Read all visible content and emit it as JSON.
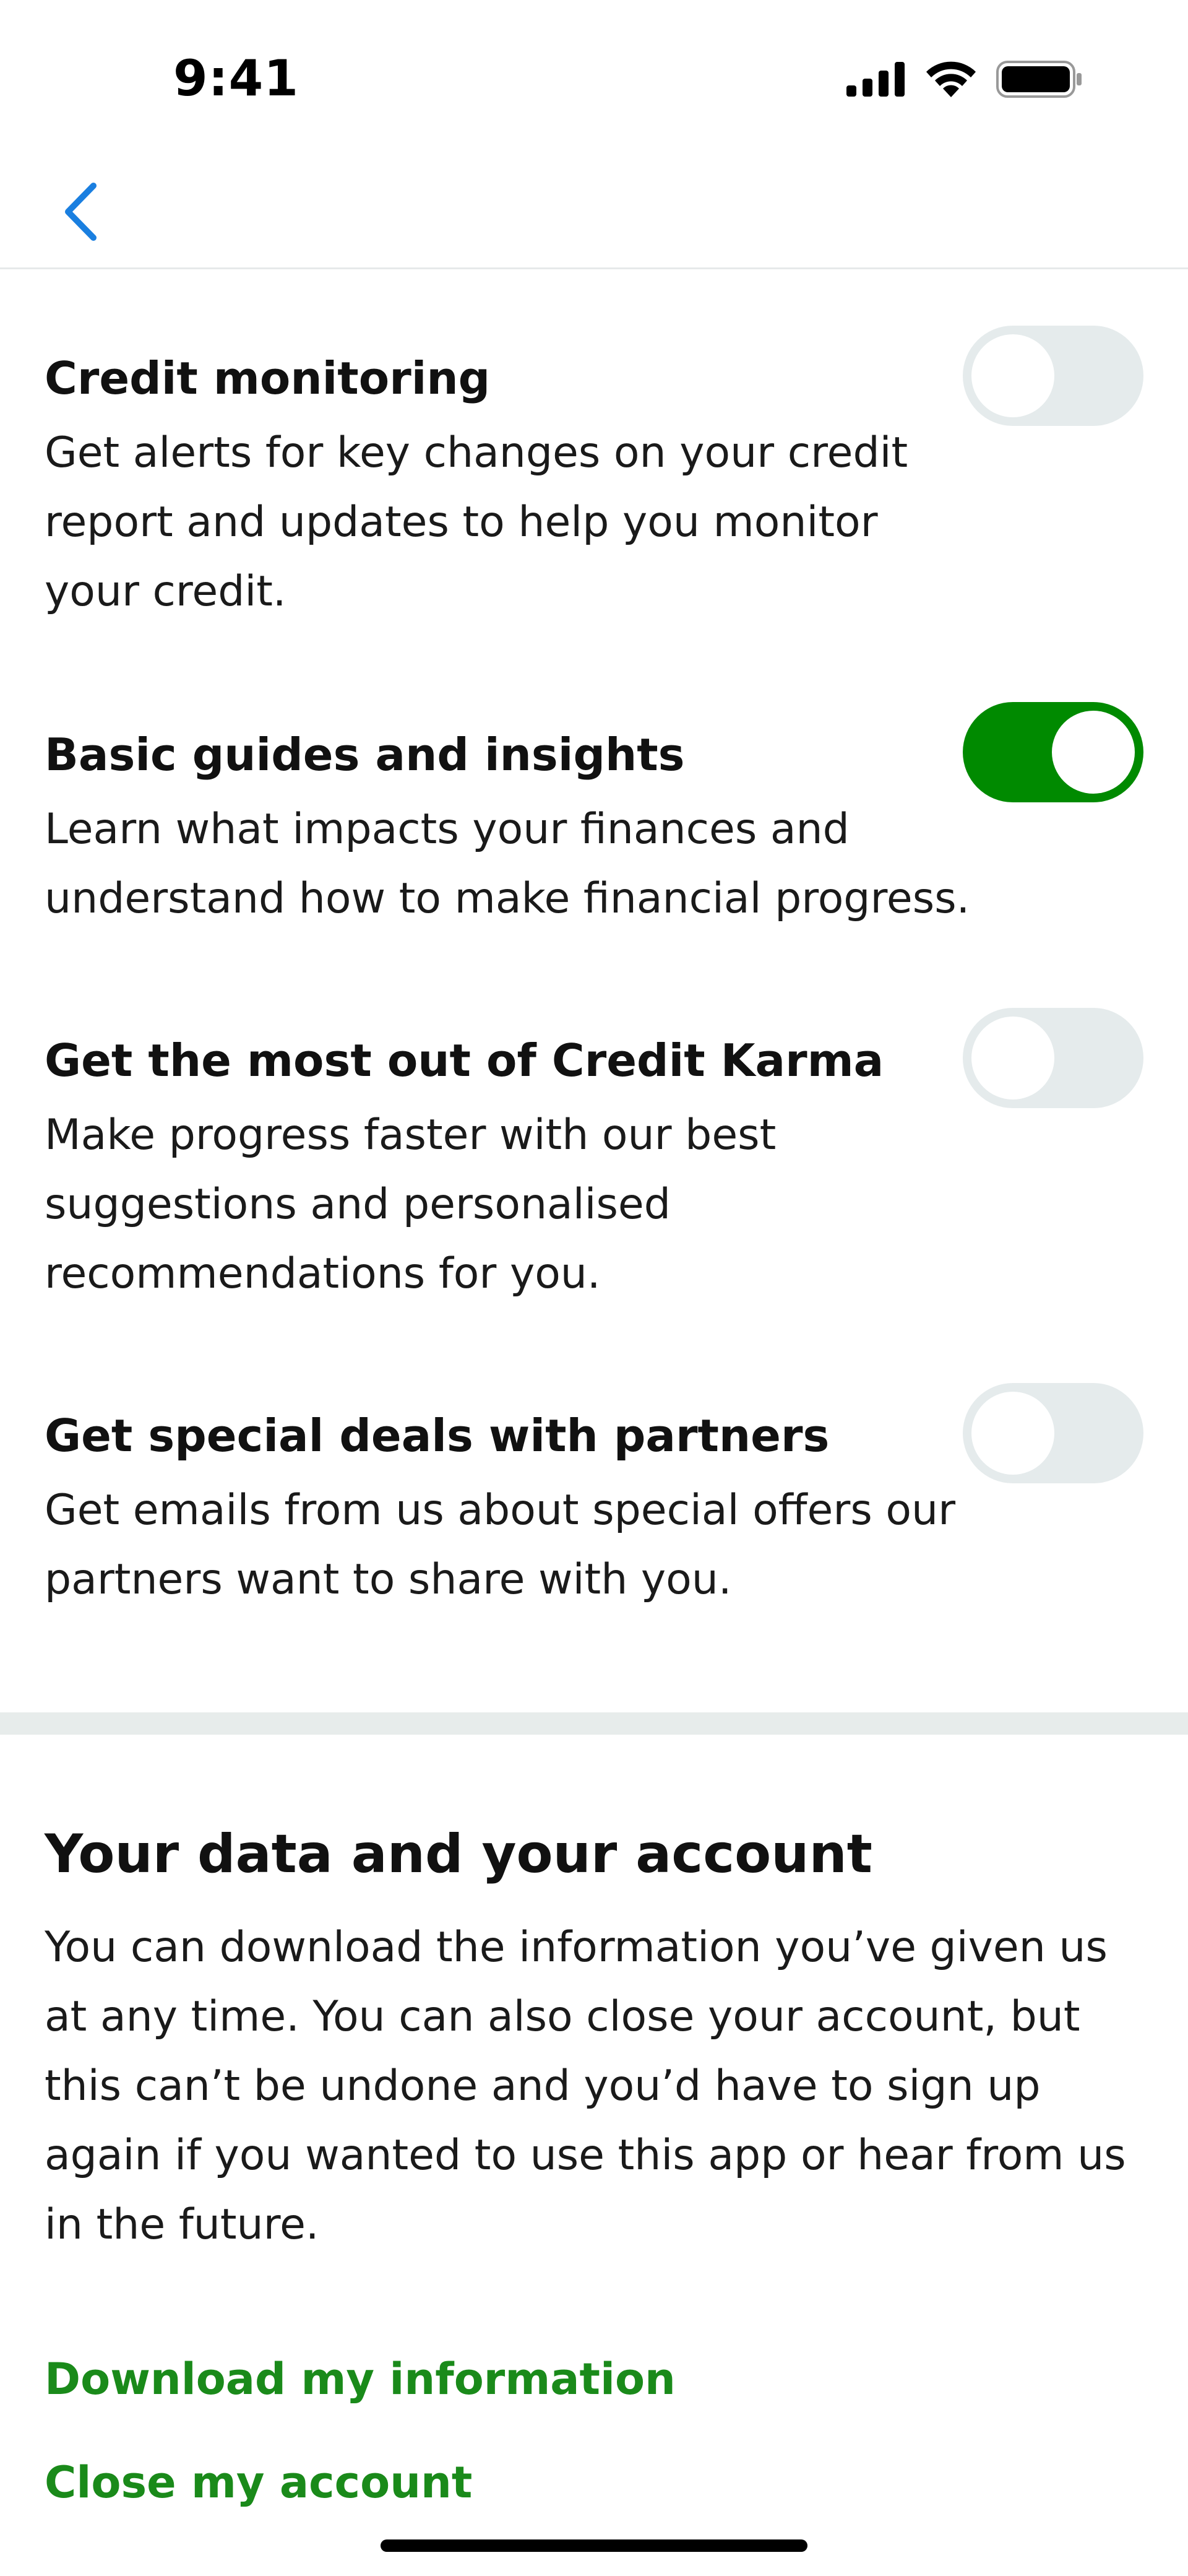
{
  "status_bar": {
    "time": "9:41",
    "icons": [
      "cellular-signal-icon",
      "wifi-icon",
      "battery-icon"
    ]
  },
  "nav": {
    "back_icon": "chevron-left-icon",
    "accent_color": "#1a7fe0"
  },
  "preferences": [
    {
      "title": "Credit monitoring",
      "description": "Get alerts for key changes on your credit report and updates to help you monitor your credit.",
      "enabled": false
    },
    {
      "title": "Basic guides and insights",
      "description": "Learn what impacts your finances and understand how to make financial progress.",
      "enabled": true
    },
    {
      "title": "Get the most out of Credit Karma",
      "description": "Make progress faster with our best suggestions and personalised recommendations for you.",
      "enabled": false
    },
    {
      "title": "Get special deals with partners",
      "description": "Get emails from us about special offers our partners want to share with you.",
      "enabled": false
    }
  ],
  "data_section": {
    "title": "Your data and your account",
    "description": "You can download the information you’ve given us at any time. You can also close your account, but this can’t be undone and you’d have to sign up again if you wanted to use this app or hear from us in the future.",
    "links": {
      "download": "Download my information",
      "close": "Close my account"
    }
  },
  "colors": {
    "toggle_on": "#008a00",
    "toggle_off": "#e5ebec",
    "link": "#1a8a1a",
    "divider": "#e7eceb"
  }
}
